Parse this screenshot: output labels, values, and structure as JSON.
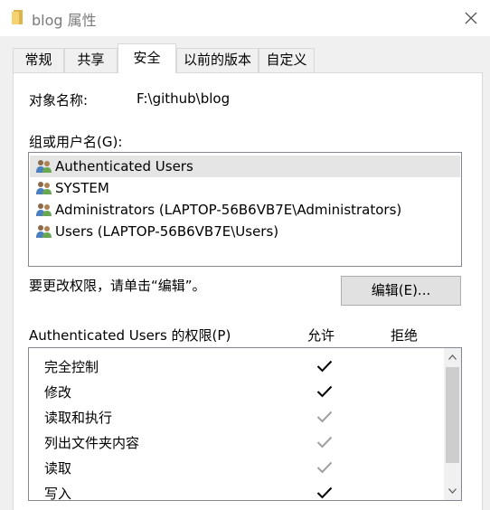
{
  "window": {
    "title": "blog 属性",
    "close_icon": "close-icon",
    "title_icon": "folder-icon"
  },
  "tabs": [
    {
      "label": "常规",
      "active": false
    },
    {
      "label": "共享",
      "active": false
    },
    {
      "label": "安全",
      "active": true
    },
    {
      "label": "以前的版本",
      "active": false
    },
    {
      "label": "自定义",
      "active": false
    }
  ],
  "security": {
    "object_name_label": "对象名称:",
    "object_name_value": "F:\\github\\blog",
    "groups_label": "组或用户名(G):",
    "users": [
      {
        "label": "Authenticated Users",
        "icon": "users-group-icon",
        "selected": true
      },
      {
        "label": "SYSTEM",
        "icon": "users-group-icon",
        "selected": false
      },
      {
        "label": "Administrators (LAPTOP-56B6VB7E\\Administrators)",
        "icon": "users-group-icon",
        "selected": false
      },
      {
        "label": "Users (LAPTOP-56B6VB7E\\Users)",
        "icon": "users-group-icon",
        "selected": false
      }
    ],
    "change_hint": "要更改权限，请单击“编辑”。",
    "edit_button": "编辑(E)...",
    "permissions_label": "Authenticated Users 的权限(P)",
    "allow_header": "允许",
    "deny_header": "拒绝",
    "permissions": [
      {
        "name": "完全控制",
        "allow": true,
        "inherited": false
      },
      {
        "name": "修改",
        "allow": true,
        "inherited": false
      },
      {
        "name": "读取和执行",
        "allow": true,
        "inherited": true
      },
      {
        "name": "列出文件夹内容",
        "allow": true,
        "inherited": true
      },
      {
        "name": "读取",
        "allow": true,
        "inherited": true
      },
      {
        "name": "写入",
        "allow": true,
        "inherited": false
      }
    ]
  },
  "colors": {
    "check_explicit": "#000000",
    "check_inherited": "#a0a0a0",
    "selected_row": "#e5e5e5"
  }
}
